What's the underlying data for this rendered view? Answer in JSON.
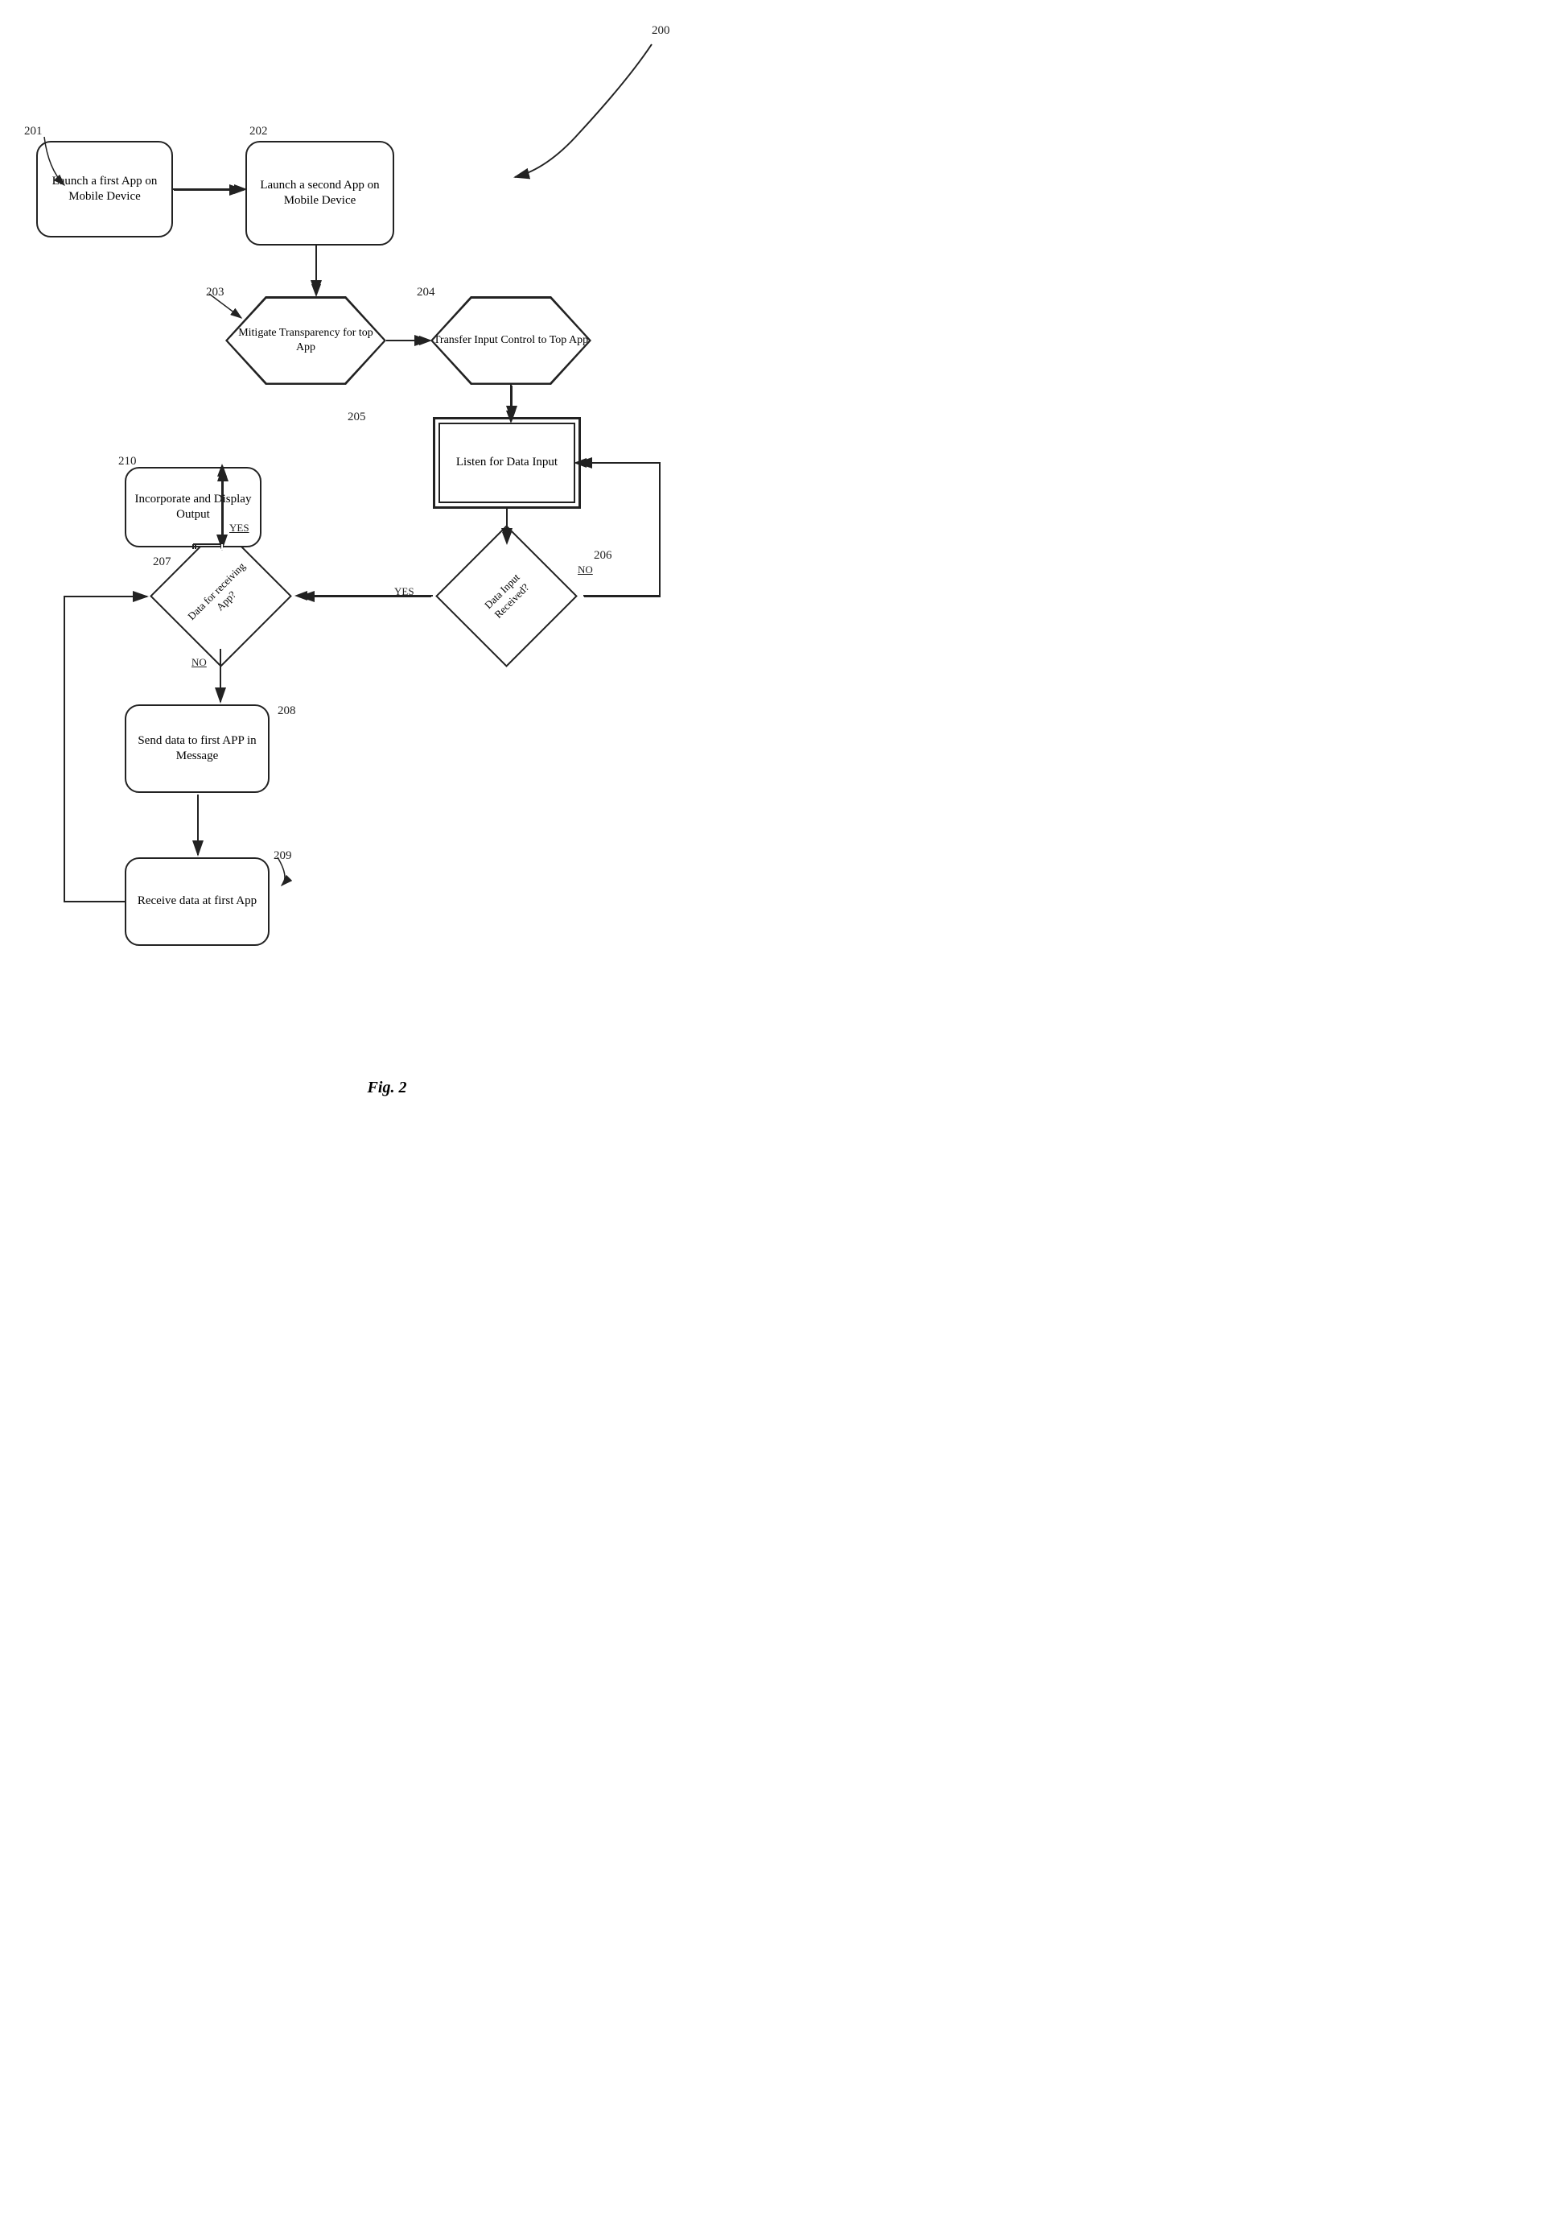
{
  "diagram": {
    "title": "200",
    "figure_label": "Fig. 2",
    "nodes": {
      "n200": {
        "label": "200"
      },
      "n201": {
        "label": "201"
      },
      "n202": {
        "label": "202"
      },
      "n203": {
        "label": "203"
      },
      "n204": {
        "label": "204"
      },
      "n205": {
        "label": "205"
      },
      "n206": {
        "label": "206"
      },
      "n207": {
        "label": "207"
      },
      "n208": {
        "label": "208"
      },
      "n209": {
        "label": "209"
      },
      "n210": {
        "label": "210"
      }
    },
    "box_201": {
      "text": "Launch a first App on Mobile Device"
    },
    "box_202": {
      "text": "Launch a second App on Mobile Device"
    },
    "hex_203": {
      "text": "Mitigate Transparency for top App"
    },
    "hex_204": {
      "text": "Transfer Input Control to Top App"
    },
    "box_205": {
      "text": "Listen for Data Input"
    },
    "diamond_206": {
      "text": "Data Input Received?"
    },
    "diamond_207": {
      "text": "Data for receiving App?"
    },
    "box_208": {
      "text": "Send data to first APP in Message"
    },
    "box_209": {
      "text": "Receive data at first App"
    },
    "box_210": {
      "text": "Incorporate and Display Output"
    },
    "labels": {
      "yes_207": "YES",
      "no_207": "NO",
      "yes_206": "YES",
      "no_206": "NO"
    }
  }
}
